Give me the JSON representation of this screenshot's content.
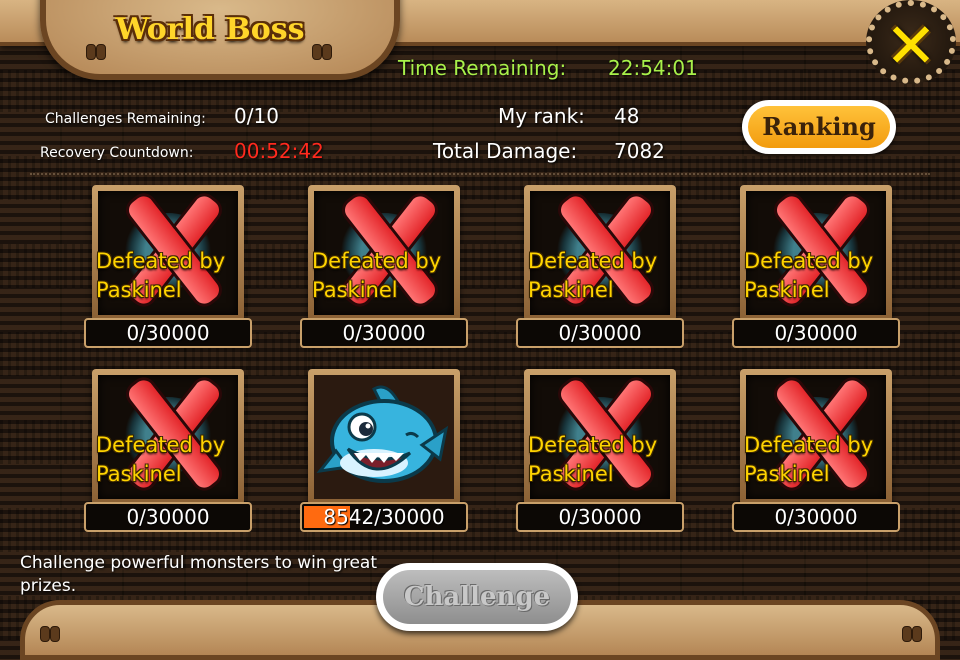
{
  "header": {
    "title": "World Boss",
    "close_icon": "close-x-icon"
  },
  "time": {
    "label": "Time Remaining:",
    "value": "22:54:01"
  },
  "stats": {
    "challenges_label": "Challenges Remaining:",
    "challenges_value": "0/10",
    "recovery_label": "Recovery Countdown:",
    "recovery_value": "00:52:42",
    "rank_label": "My rank:",
    "rank_value": "48",
    "damage_label": "Total Damage:",
    "damage_value": "7082"
  },
  "ranking_button": "Ranking",
  "bosses": [
    {
      "status": "Defeated by Paskinel",
      "hp": "0/30000",
      "hp_fraction": 0
    },
    {
      "status": "Defeated by Paskinel",
      "hp": "0/30000",
      "hp_fraction": 0
    },
    {
      "status": "Defeated by Paskinel",
      "hp": "0/30000",
      "hp_fraction": 0
    },
    {
      "status": "Defeated by Paskinel",
      "hp": "0/30000",
      "hp_fraction": 0
    },
    {
      "status": "Defeated by Paskinel",
      "hp": "0/30000",
      "hp_fraction": 0
    },
    {
      "status": "",
      "hp": "8542/30000",
      "hp_fraction": 0.285,
      "icon": "shark-boss-icon"
    },
    {
      "status": "Defeated by Paskinel",
      "hp": "0/30000",
      "hp_fraction": 0
    },
    {
      "status": "Defeated by Paskinel",
      "hp": "0/30000",
      "hp_fraction": 0
    }
  ],
  "footer": {
    "description": "Challenge powerful monsters to win great prizes.",
    "challenge_button": "Challenge"
  },
  "colors": {
    "accent": "#ffd400",
    "timer_green": "#a8f04a",
    "countdown_red": "#ff2a1e",
    "hp_fill": "#ff6a10"
  }
}
